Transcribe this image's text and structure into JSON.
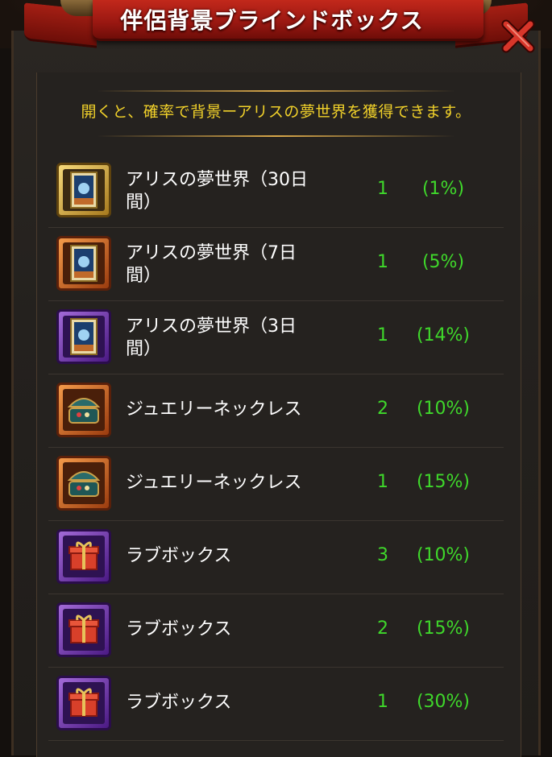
{
  "title": "伴侶背景ブラインドボックス",
  "description": "開くと、確率で背景ーアリスの夢世界を獲得できます。",
  "colors": {
    "title_banner": "#b0201a",
    "description_text": "#f1d12a",
    "value_text": "#3fd82b",
    "item_name_text": "#ffffff",
    "panel_bg": "#25221f"
  },
  "items": [
    {
      "name": "アリスの夢世界（30日間）",
      "name_line1": "アリスの夢世界（30日",
      "name_line2": "間）",
      "quantity": "1",
      "probability": "(1%)",
      "icon": "dream-world-card-icon",
      "frame": "gold"
    },
    {
      "name": "アリスの夢世界（7日間）",
      "name_line1": "アリスの夢世界（7日",
      "name_line2": "間）",
      "quantity": "1",
      "probability": "(5%)",
      "icon": "dream-world-card-icon",
      "frame": "orange"
    },
    {
      "name": "アリスの夢世界（3日間）",
      "name_line1": "アリスの夢世界（3日",
      "name_line2": "間）",
      "quantity": "1",
      "probability": "(14%)",
      "icon": "dream-world-card-icon",
      "frame": "purple"
    },
    {
      "name": "ジュエリーネックレス",
      "quantity": "2",
      "probability": "(10%)",
      "icon": "jewelry-box-icon",
      "frame": "orange"
    },
    {
      "name": "ジュエリーネックレス",
      "quantity": "1",
      "probability": "(15%)",
      "icon": "jewelry-box-icon",
      "frame": "orange"
    },
    {
      "name": "ラブボックス",
      "quantity": "3",
      "probability": "(10%)",
      "icon": "gift-box-icon",
      "frame": "purple"
    },
    {
      "name": "ラブボックス",
      "quantity": "2",
      "probability": "(15%)",
      "icon": "gift-box-icon",
      "frame": "purple"
    },
    {
      "name": "ラブボックス",
      "quantity": "1",
      "probability": "(30%)",
      "icon": "gift-box-icon",
      "frame": "purple"
    }
  ]
}
